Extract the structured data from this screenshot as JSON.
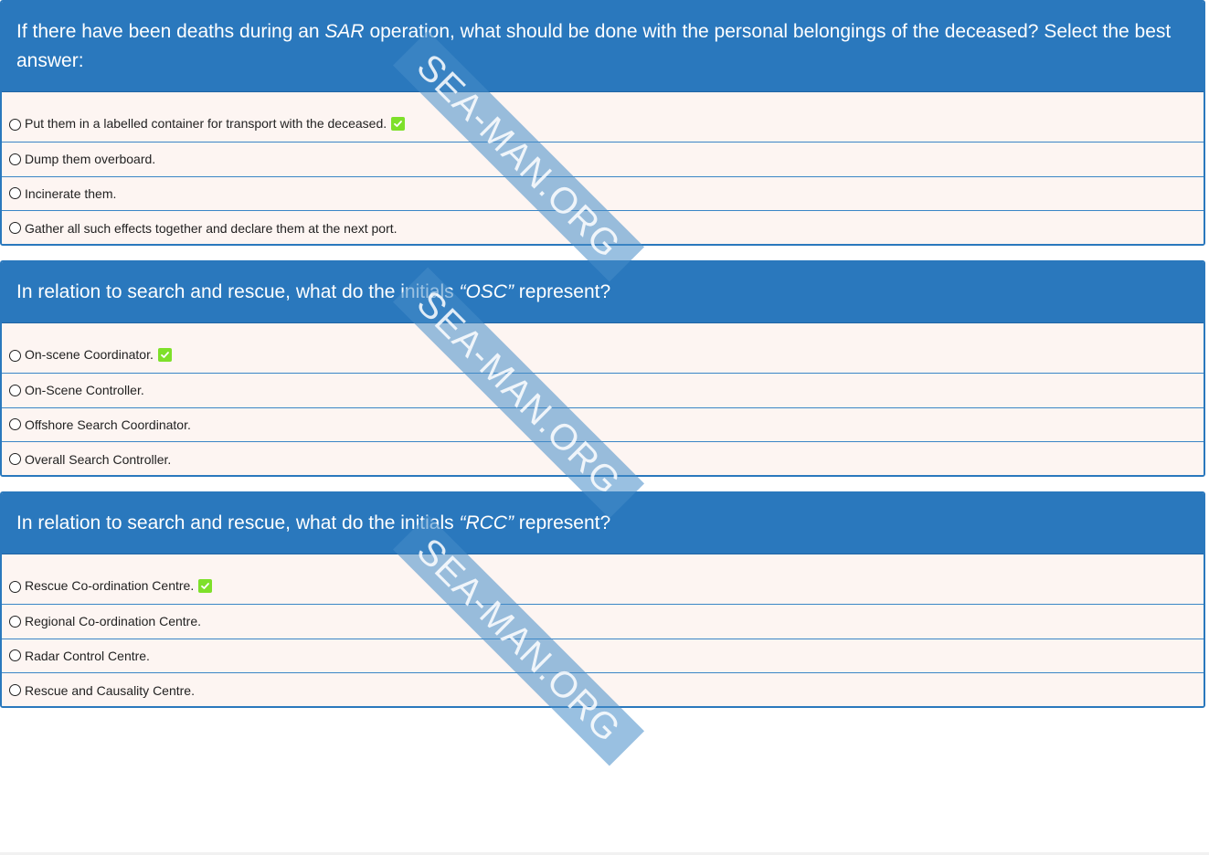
{
  "questions": [
    {
      "text_before": "If there have been deaths during an ",
      "text_em": "SAR",
      "text_after": " operation, what should be done with the personal belongings of the deceased? Select the best answer:",
      "options": [
        {
          "label": "Put them in a labelled container for transport with the deceased.",
          "correct": true
        },
        {
          "label": "Dump them overboard.",
          "correct": false
        },
        {
          "label": "Incinerate them.",
          "correct": false
        },
        {
          "label": "Gather all such effects together and declare them at the next port.",
          "correct": false
        }
      ]
    },
    {
      "text_before": "In relation to search and rescue, what do the initials ",
      "text_em": "“OSC”",
      "text_after": " represent?",
      "options": [
        {
          "label": "On-scene Coordinator.",
          "correct": true
        },
        {
          "label": "On-Scene Controller.",
          "correct": false
        },
        {
          "label": "Offshore Search Coordinator.",
          "correct": false
        },
        {
          "label": "Overall Search Controller.",
          "correct": false
        }
      ]
    },
    {
      "text_before": "In relation to search and rescue, what do the initials ",
      "text_em": "“RCC”",
      "text_after": " represent?",
      "options": [
        {
          "label": "Rescue Co-ordination Centre.",
          "correct": true
        },
        {
          "label": "Regional Co-ordination Centre.",
          "correct": false
        },
        {
          "label": "Radar Control Centre.",
          "correct": false
        },
        {
          "label": "Rescue and Causality Centre.",
          "correct": false
        }
      ]
    }
  ],
  "watermark": {
    "text": "SEA-MAN.ORG"
  },
  "colors": {
    "header": "#2a78bd",
    "row_bg": "#fdf5f2",
    "correct_badge": "#7ee02a"
  }
}
